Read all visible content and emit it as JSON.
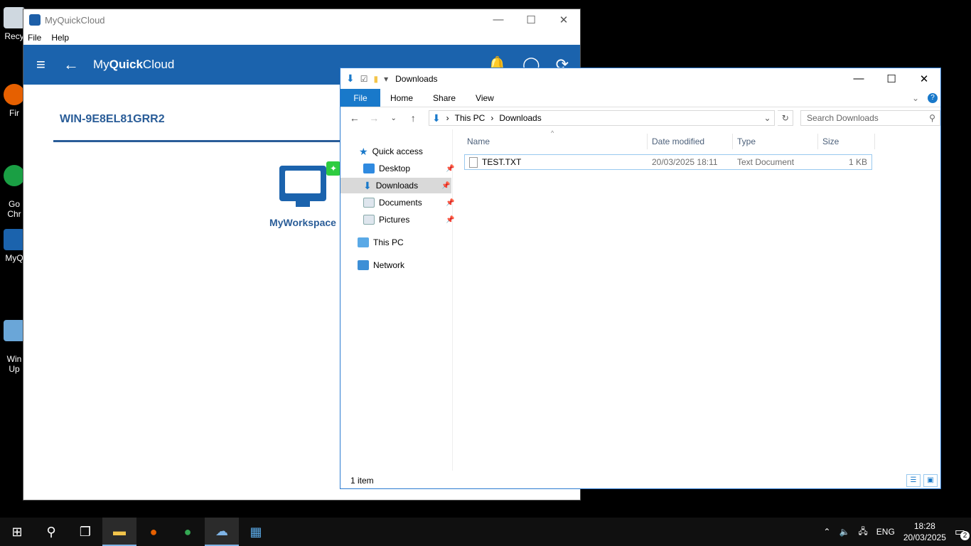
{
  "desktop": {
    "icons": [
      {
        "label": "Recy"
      },
      {
        "label": "Fir"
      },
      {
        "label": "Go\nChr"
      },
      {
        "label": "MyQ"
      },
      {
        "label": "Win\nUp"
      }
    ]
  },
  "myquickcloud": {
    "window_title": "MyQuickCloud",
    "menu": [
      "File",
      "Help"
    ],
    "logo_prefix": "My",
    "logo_bold": "Quick",
    "logo_suffix": "Cloud",
    "machine_name": "WIN-9E8EL81GRR2",
    "workspace_label": "MyWorkspace",
    "colors": {
      "header": "#1b63ad",
      "accent": "#2a5d98"
    }
  },
  "explorer": {
    "window_title": "Downloads",
    "ribbon": {
      "file": "File",
      "tabs": [
        "Home",
        "Share",
        "View"
      ]
    },
    "address": {
      "crumbs": [
        "This PC",
        "Downloads"
      ]
    },
    "search_placeholder": "Search Downloads",
    "nav": {
      "quick_access": "Quick access",
      "items": [
        "Desktop",
        "Downloads",
        "Documents",
        "Pictures"
      ],
      "this_pc": "This PC",
      "network": "Network"
    },
    "columns": {
      "name": "Name",
      "date": "Date modified",
      "type": "Type",
      "size": "Size"
    },
    "files": [
      {
        "name": "TEST.TXT",
        "date": "20/03/2025 18:11",
        "type": "Text Document",
        "size": "1 KB"
      }
    ],
    "status": "1 item"
  },
  "taskbar": {
    "lang": "ENG",
    "time": "18:28",
    "date": "20/03/2025",
    "notifications": "2"
  }
}
